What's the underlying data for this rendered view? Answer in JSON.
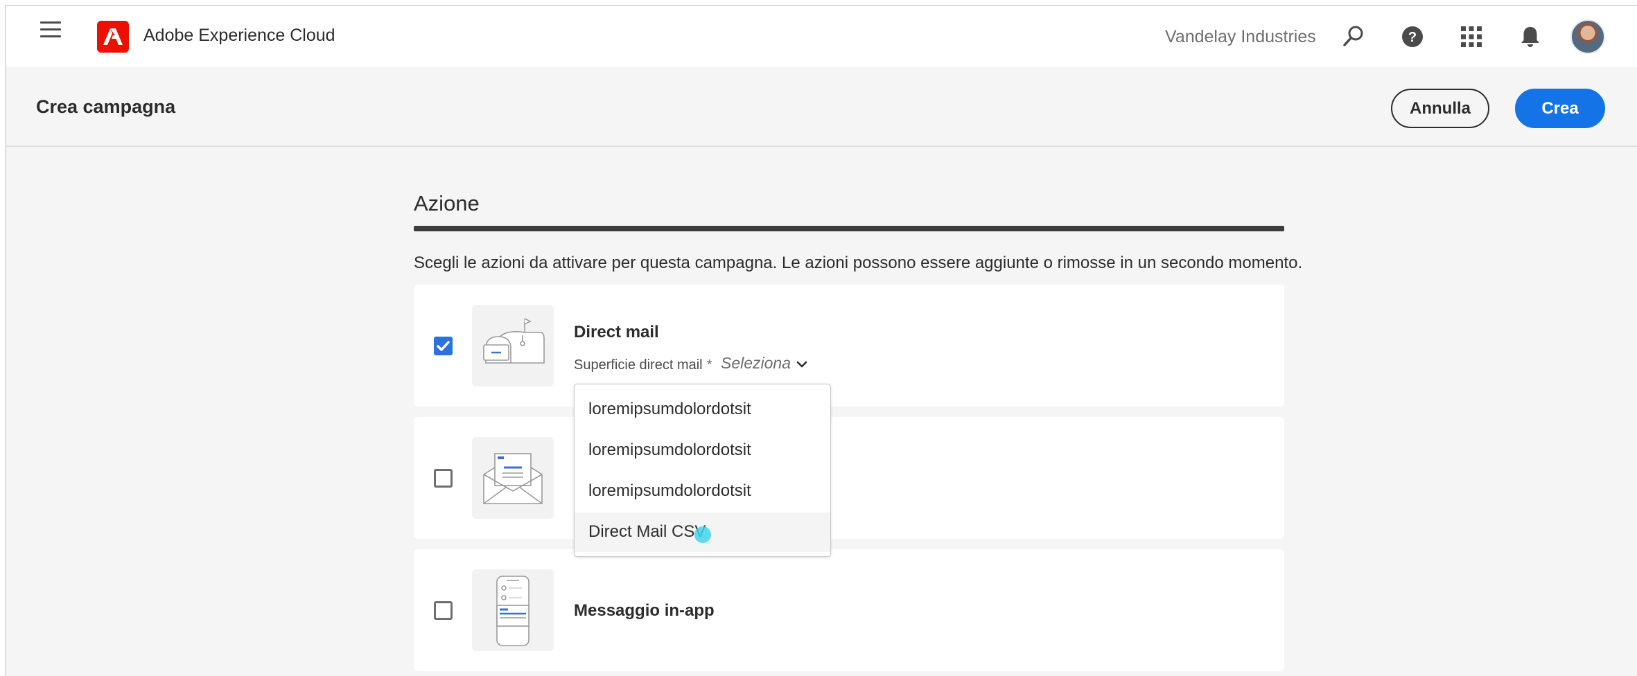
{
  "app": {
    "title": "Adobe Experience Cloud",
    "org": "Vandelay Industries"
  },
  "topbar_icons": [
    "menu-icon",
    "adobe-logo",
    "search-icon",
    "help-icon",
    "apps-grid-icon",
    "notification-bell-icon",
    "user-avatar"
  ],
  "header": {
    "title": "Crea campagna",
    "cancel_label": "Annulla",
    "create_label": "Crea"
  },
  "section": {
    "title": "Azione",
    "description": "Scegli le azioni da attivare per questa campagna. Le azioni possono essere aggiunte o rimosse in un secondo momento."
  },
  "actions": [
    {
      "title": "Direct mail",
      "checked": true,
      "field_label": "Superficie direct mail",
      "required_mark": "*",
      "select_placeholder": "Seleziona",
      "icon": "mailbox-icon"
    },
    {
      "title": "",
      "checked": false,
      "icon": "envelope-icon"
    },
    {
      "title": "Messaggio in-app",
      "checked": false,
      "icon": "mobile-phone-icon"
    }
  ],
  "dropdown": {
    "options": [
      "loremipsumdolordotsit",
      "loremipsumdolordotsit",
      "loremipsumdolordotsit",
      "Direct Mail CSV"
    ],
    "hovered_index": 3
  },
  "colors": {
    "accent": "#1473e6",
    "adobe_red": "#eb1000",
    "checkbox_checked": "#2a72de"
  }
}
